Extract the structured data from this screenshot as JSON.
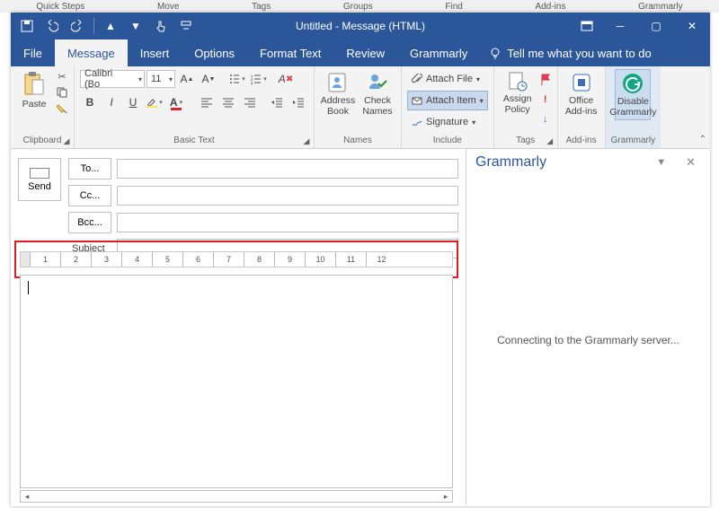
{
  "bg_tabs": [
    "Quick Steps",
    "Move",
    "Tags",
    "Groups",
    "Find",
    "Add-ins",
    "Grammarly"
  ],
  "window": {
    "title": "Untitled  -  Message (HTML)"
  },
  "tabs": {
    "file": "File",
    "message": "Message",
    "insert": "Insert",
    "options": "Options",
    "format": "Format Text",
    "review": "Review",
    "grammarly": "Grammarly",
    "tell": "Tell me what you want to do"
  },
  "ribbon": {
    "clipboard": {
      "label": "Clipboard",
      "paste": "Paste"
    },
    "basic_text": {
      "label": "Basic Text",
      "font": "Calibri (Bo",
      "size": "11",
      "bold": "B",
      "italic": "I",
      "underline": "U"
    },
    "names": {
      "label": "Names",
      "address": "Address Book",
      "check": "Check Names"
    },
    "include": {
      "label": "Include",
      "attach_file": "Attach File",
      "attach_item": "Attach Item",
      "signature": "Signature"
    },
    "tags": {
      "label": "Tags",
      "assign": "Assign Policy"
    },
    "addins": {
      "label": "Add-ins",
      "office": "Office Add-ins"
    },
    "grammarly": {
      "label": "Grammarly",
      "disable": "Disable Grammarly"
    }
  },
  "compose": {
    "send": "Send",
    "to": "To...",
    "cc": "Cc...",
    "bcc": "Bcc...",
    "subject": "Subject"
  },
  "ruler": [
    "1",
    "2",
    "3",
    "4",
    "5",
    "6",
    "7",
    "8",
    "9",
    "10",
    "11",
    "12"
  ],
  "grammarly_pane": {
    "title": "Grammarly",
    "status": "Connecting to the Grammarly server..."
  }
}
